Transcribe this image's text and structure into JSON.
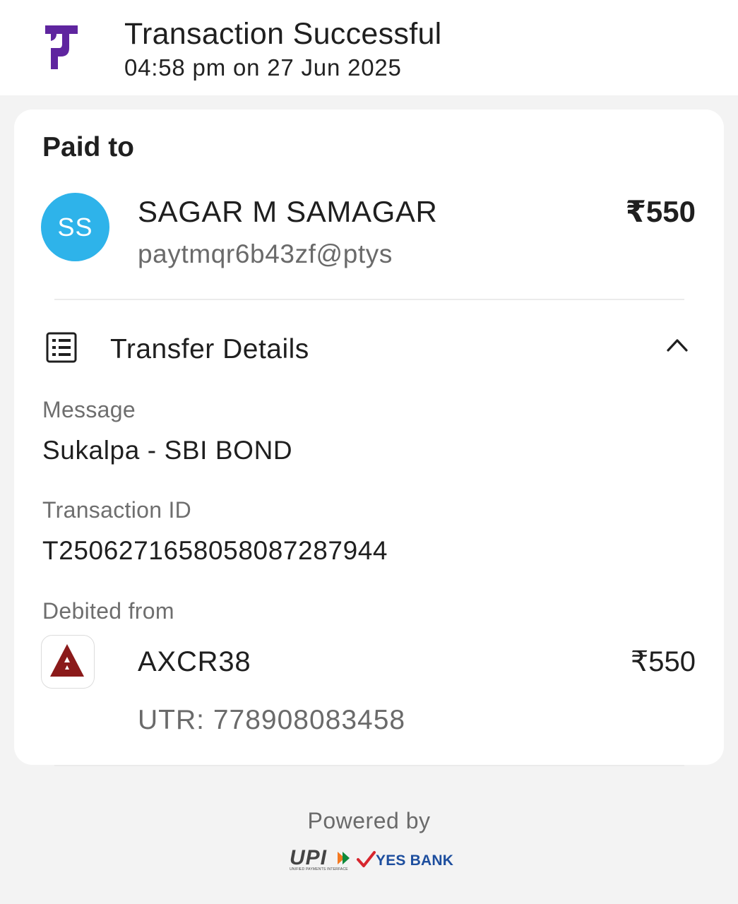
{
  "header": {
    "logo_icon": "phonepe-logo-icon",
    "title": "Transaction Successful",
    "subtitle": "04:58 pm on 27 Jun 2025"
  },
  "paid_to": {
    "label": "Paid to",
    "avatar_initials": "SS",
    "name": "SAGAR M SAMAGAR",
    "upi_id": "paytmqr6b43zf@ptys",
    "amount": "₹550"
  },
  "transfer_details": {
    "icon": "document-list-icon",
    "label": "Transfer Details",
    "toggle_icon": "chevron-up-icon",
    "message_label": "Message",
    "message_value": "Sukalpa - SBI BOND",
    "txn_id_label": "Transaction ID",
    "txn_id_value": "T2506271658058087287944",
    "debited_label": "Debited from",
    "bank_icon": "axis-bank-logo-icon",
    "bank_account": "AXCR38",
    "bank_amount": "₹550",
    "utr": "UTR: 778908083458"
  },
  "footer": {
    "powered_by": "Powered by",
    "upi_logo_text": "UPI",
    "upi_logo_sub": "UNIFIED PAYMENTS INTERFACE",
    "bank_partner": "YES BANK"
  },
  "colors": {
    "brand_purple": "#5f259f",
    "avatar_blue": "#2eb3ea",
    "axis_maroon": "#8b1a1a",
    "yes_blue": "#1d4e9e",
    "yes_red": "#d7262e"
  }
}
